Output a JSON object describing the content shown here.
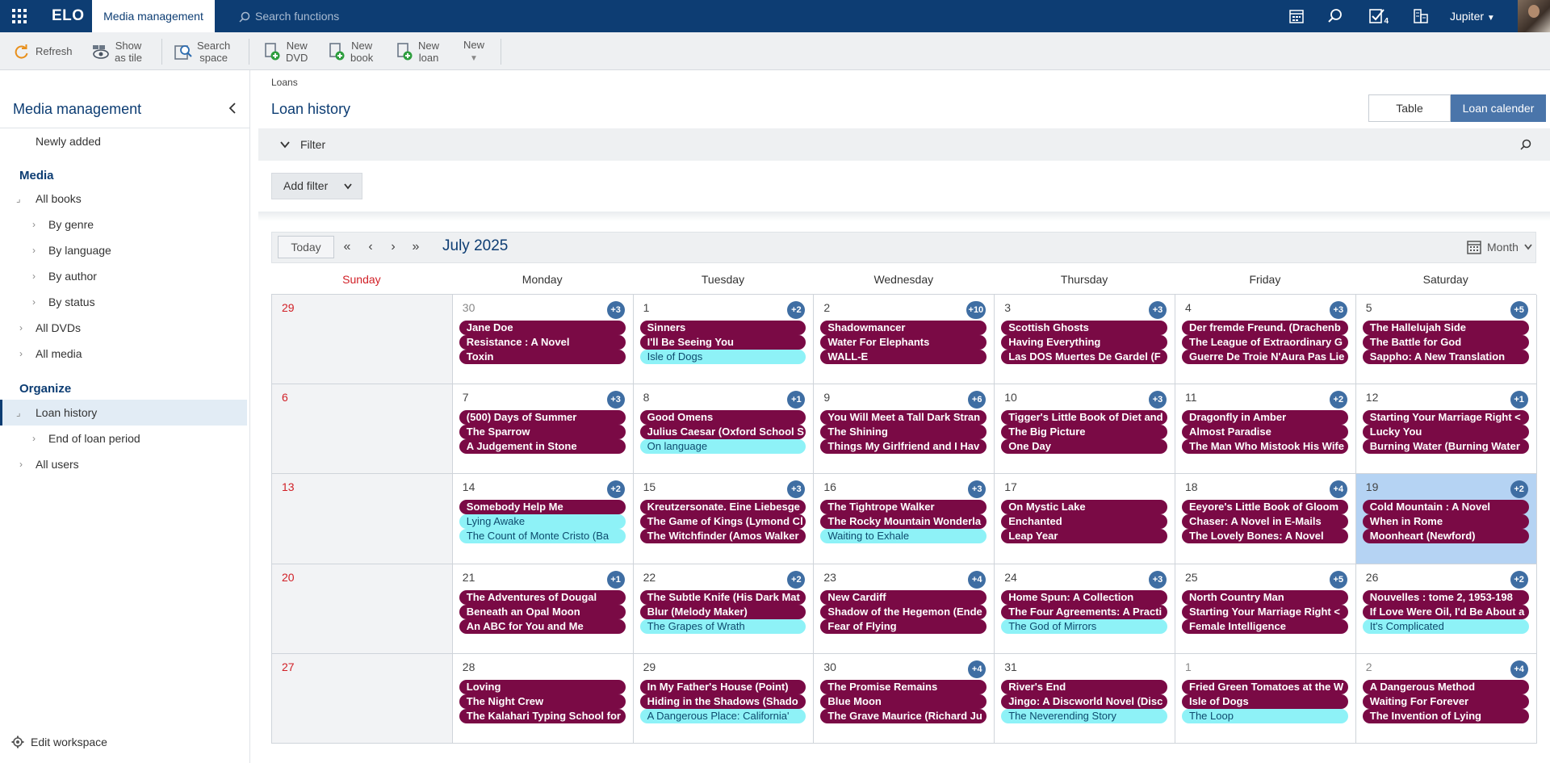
{
  "topbar": {
    "logo": "ELO",
    "app_tab": "Media management",
    "search_placeholder": "Search functions",
    "tasks_badge": "4",
    "user": "Jupiter"
  },
  "toolbar": {
    "refresh": "Refresh",
    "show_tile_1": "Show",
    "show_tile_2": "as tile",
    "search_space_1": "Search",
    "search_space_2": "space",
    "new_dvd_1": "New",
    "new_dvd_2": "DVD",
    "new_book_1": "New",
    "new_book_2": "book",
    "new_loan_1": "New",
    "new_loan_2": "loan",
    "new": "New"
  },
  "sidebar": {
    "title": "Media management",
    "newly_added": "Newly added",
    "media_heading": "Media",
    "all_books": "All books",
    "by_genre": "By genre",
    "by_language": "By language",
    "by_author": "By author",
    "by_status": "By status",
    "all_dvds": "All DVDs",
    "all_media": "All media",
    "organize_heading": "Organize",
    "loan_history": "Loan history",
    "end_of_loan": "End of loan period",
    "all_users": "All users",
    "edit_workspace": "Edit workspace"
  },
  "main": {
    "breadcrumb": "Loans",
    "title": "Loan history",
    "view_table": "Table",
    "view_calendar": "Loan calender",
    "filter_label": "Filter",
    "add_filter": "Add filter"
  },
  "calendar": {
    "today": "Today",
    "month": "July 2025",
    "view_mode": "Month",
    "weekdays": [
      "Sunday",
      "Monday",
      "Tuesday",
      "Wednesday",
      "Thursday",
      "Friday",
      "Saturday"
    ],
    "weeks": [
      [
        {
          "day": "29",
          "more": "",
          "events": []
        },
        {
          "day": "30",
          "more": "+3",
          "events": [
            {
              "t": "Jane Doe",
              "c": "m"
            },
            {
              "t": "Resistance : A Novel",
              "c": "m"
            },
            {
              "t": "Toxin",
              "c": "m"
            }
          ]
        },
        {
          "day": "1",
          "more": "+2",
          "events": [
            {
              "t": "Sinners",
              "c": "m"
            },
            {
              "t": "I'll Be Seeing You",
              "c": "m"
            },
            {
              "t": "Isle of Dogs",
              "c": "c"
            }
          ]
        },
        {
          "day": "2",
          "more": "+10",
          "events": [
            {
              "t": "Shadowmancer",
              "c": "m"
            },
            {
              "t": "Water For Elephants",
              "c": "m"
            },
            {
              "t": "WALL-E",
              "c": "m"
            }
          ]
        },
        {
          "day": "3",
          "more": "+3",
          "events": [
            {
              "t": "Scottish Ghosts",
              "c": "m"
            },
            {
              "t": "Having Everything",
              "c": "m"
            },
            {
              "t": "Las DOS Muertes De Gardel (F",
              "c": "m"
            }
          ]
        },
        {
          "day": "4",
          "more": "+3",
          "events": [
            {
              "t": "Der fremde Freund. (Drachenb",
              "c": "m"
            },
            {
              "t": "The League of Extraordinary G",
              "c": "m"
            },
            {
              "t": "Guerre De Troie N'Aura Pas Lie",
              "c": "m"
            }
          ]
        },
        {
          "day": "5",
          "more": "+5",
          "events": [
            {
              "t": "The Hallelujah Side",
              "c": "m"
            },
            {
              "t": "The Battle for God",
              "c": "m"
            },
            {
              "t": "Sappho: A New Translation",
              "c": "m"
            }
          ]
        }
      ],
      [
        {
          "day": "6",
          "more": "",
          "events": []
        },
        {
          "day": "7",
          "more": "+3",
          "events": [
            {
              "t": "(500) Days of Summer",
              "c": "m"
            },
            {
              "t": "The Sparrow",
              "c": "m"
            },
            {
              "t": "A Judgement in Stone",
              "c": "m"
            }
          ]
        },
        {
          "day": "8",
          "more": "+1",
          "events": [
            {
              "t": "Good Omens",
              "c": "m"
            },
            {
              "t": "Julius Caesar (Oxford School S",
              "c": "m"
            },
            {
              "t": "On language",
              "c": "c"
            }
          ]
        },
        {
          "day": "9",
          "more": "+6",
          "events": [
            {
              "t": "You Will Meet a Tall Dark Stran",
              "c": "m"
            },
            {
              "t": "The Shining",
              "c": "m"
            },
            {
              "t": "Things My Girlfriend and I Hav",
              "c": "m"
            }
          ]
        },
        {
          "day": "10",
          "more": "+3",
          "events": [
            {
              "t": "Tigger's Little Book of Diet and",
              "c": "m"
            },
            {
              "t": "The Big Picture",
              "c": "m"
            },
            {
              "t": "One Day",
              "c": "m"
            }
          ]
        },
        {
          "day": "11",
          "more": "+2",
          "events": [
            {
              "t": "Dragonfly in Amber",
              "c": "m"
            },
            {
              "t": "Almost Paradise",
              "c": "m"
            },
            {
              "t": "The Man Who Mistook His Wife",
              "c": "m"
            }
          ]
        },
        {
          "day": "12",
          "more": "+1",
          "events": [
            {
              "t": "Starting Your Marriage Right <",
              "c": "m"
            },
            {
              "t": "Lucky You",
              "c": "m"
            },
            {
              "t": "Burning Water (Burning Water",
              "c": "m"
            }
          ]
        }
      ],
      [
        {
          "day": "13",
          "more": "",
          "events": []
        },
        {
          "day": "14",
          "more": "+2",
          "events": [
            {
              "t": "Somebody Help Me",
              "c": "m"
            },
            {
              "t": "Lying Awake",
              "c": "c"
            },
            {
              "t": "The Count of Monte Cristo (Ba",
              "c": "c"
            }
          ]
        },
        {
          "day": "15",
          "more": "+3",
          "events": [
            {
              "t": "Kreutzersonate. Eine Liebesge",
              "c": "m"
            },
            {
              "t": "The Game of Kings (Lymond Cl",
              "c": "m"
            },
            {
              "t": "The Witchfinder (Amos Walker",
              "c": "m"
            }
          ]
        },
        {
          "day": "16",
          "more": "+3",
          "events": [
            {
              "t": "The Tightrope Walker",
              "c": "m"
            },
            {
              "t": "The Rocky Mountain Wonderla",
              "c": "m"
            },
            {
              "t": "Waiting to Exhale",
              "c": "c"
            }
          ]
        },
        {
          "day": "17",
          "more": "",
          "events": [
            {
              "t": "On Mystic Lake",
              "c": "m"
            },
            {
              "t": "Enchanted",
              "c": "m"
            },
            {
              "t": "Leap Year",
              "c": "m"
            }
          ]
        },
        {
          "day": "18",
          "more": "+4",
          "events": [
            {
              "t": "Eeyore's Little Book of Gloom",
              "c": "m"
            },
            {
              "t": "Chaser: A Novel in E-Mails",
              "c": "m"
            },
            {
              "t": "The Lovely Bones: A Novel",
              "c": "m"
            }
          ]
        },
        {
          "day": "19",
          "more": "+2",
          "events": [
            {
              "t": "Cold Mountain : A Novel",
              "c": "m"
            },
            {
              "t": "When in Rome",
              "c": "m"
            },
            {
              "t": "Moonheart (Newford)",
              "c": "m"
            }
          ]
        }
      ],
      [
        {
          "day": "20",
          "more": "",
          "events": []
        },
        {
          "day": "21",
          "more": "+1",
          "events": [
            {
              "t": "The Adventures of Dougal",
              "c": "m"
            },
            {
              "t": "Beneath an Opal Moon",
              "c": "m"
            },
            {
              "t": "An ABC for You and Me",
              "c": "m"
            }
          ]
        },
        {
          "day": "22",
          "more": "+2",
          "events": [
            {
              "t": "The Subtle Knife (His Dark Mat",
              "c": "m"
            },
            {
              "t": "Blur (Melody Maker)",
              "c": "m"
            },
            {
              "t": "The Grapes of Wrath",
              "c": "c"
            }
          ]
        },
        {
          "day": "23",
          "more": "+4",
          "events": [
            {
              "t": "New Cardiff",
              "c": "m"
            },
            {
              "t": "Shadow of the Hegemon (Ende",
              "c": "m"
            },
            {
              "t": "Fear of Flying",
              "c": "m"
            }
          ]
        },
        {
          "day": "24",
          "more": "+3",
          "events": [
            {
              "t": "Home Spun: A Collection",
              "c": "m"
            },
            {
              "t": "The Four Agreements: A Practi",
              "c": "m"
            },
            {
              "t": "The God of Mirrors",
              "c": "c"
            }
          ]
        },
        {
          "day": "25",
          "more": "+5",
          "events": [
            {
              "t": "North Country Man",
              "c": "m"
            },
            {
              "t": "Starting Your Marriage Right <",
              "c": "m"
            },
            {
              "t": "Female Intelligence",
              "c": "m"
            }
          ]
        },
        {
          "day": "26",
          "more": "+2",
          "events": [
            {
              "t": "Nouvelles : tome 2, 1953-198",
              "c": "m"
            },
            {
              "t": "If Love Were Oil, I'd Be About a",
              "c": "m"
            },
            {
              "t": "It's Complicated",
              "c": "c"
            }
          ]
        }
      ],
      [
        {
          "day": "27",
          "more": "",
          "events": []
        },
        {
          "day": "28",
          "more": "",
          "events": [
            {
              "t": "Loving",
              "c": "m"
            },
            {
              "t": "The Night Crew",
              "c": "m"
            },
            {
              "t": "The Kalahari Typing School for",
              "c": "m"
            }
          ]
        },
        {
          "day": "29",
          "more": "",
          "events": [
            {
              "t": "In My Father's House (Point)",
              "c": "m"
            },
            {
              "t": "Hiding in the Shadows (Shado",
              "c": "m"
            },
            {
              "t": "A Dangerous Place: California'",
              "c": "c"
            }
          ]
        },
        {
          "day": "30",
          "more": "+4",
          "events": [
            {
              "t": "The Promise Remains",
              "c": "m"
            },
            {
              "t": "Blue Moon",
              "c": "m"
            },
            {
              "t": "The Grave Maurice (Richard Ju",
              "c": "m"
            }
          ]
        },
        {
          "day": "31",
          "more": "",
          "events": [
            {
              "t": "River's End",
              "c": "m"
            },
            {
              "t": "Jingo: A Discworld Novel (Disc",
              "c": "m"
            },
            {
              "t": "The Neverending Story",
              "c": "c"
            }
          ]
        },
        {
          "day": "1",
          "more": "",
          "events": [
            {
              "t": "Fried Green Tomatoes at the W",
              "c": "m"
            },
            {
              "t": "Isle of Dogs",
              "c": "m"
            },
            {
              "t": "The Loop",
              "c": "c"
            }
          ]
        },
        {
          "day": "2",
          "more": "+4",
          "events": [
            {
              "t": "A Dangerous Method",
              "c": "m"
            },
            {
              "t": "Waiting For Forever",
              "c": "m"
            },
            {
              "t": "The Invention of Lying",
              "c": "m"
            }
          ]
        }
      ]
    ]
  }
}
